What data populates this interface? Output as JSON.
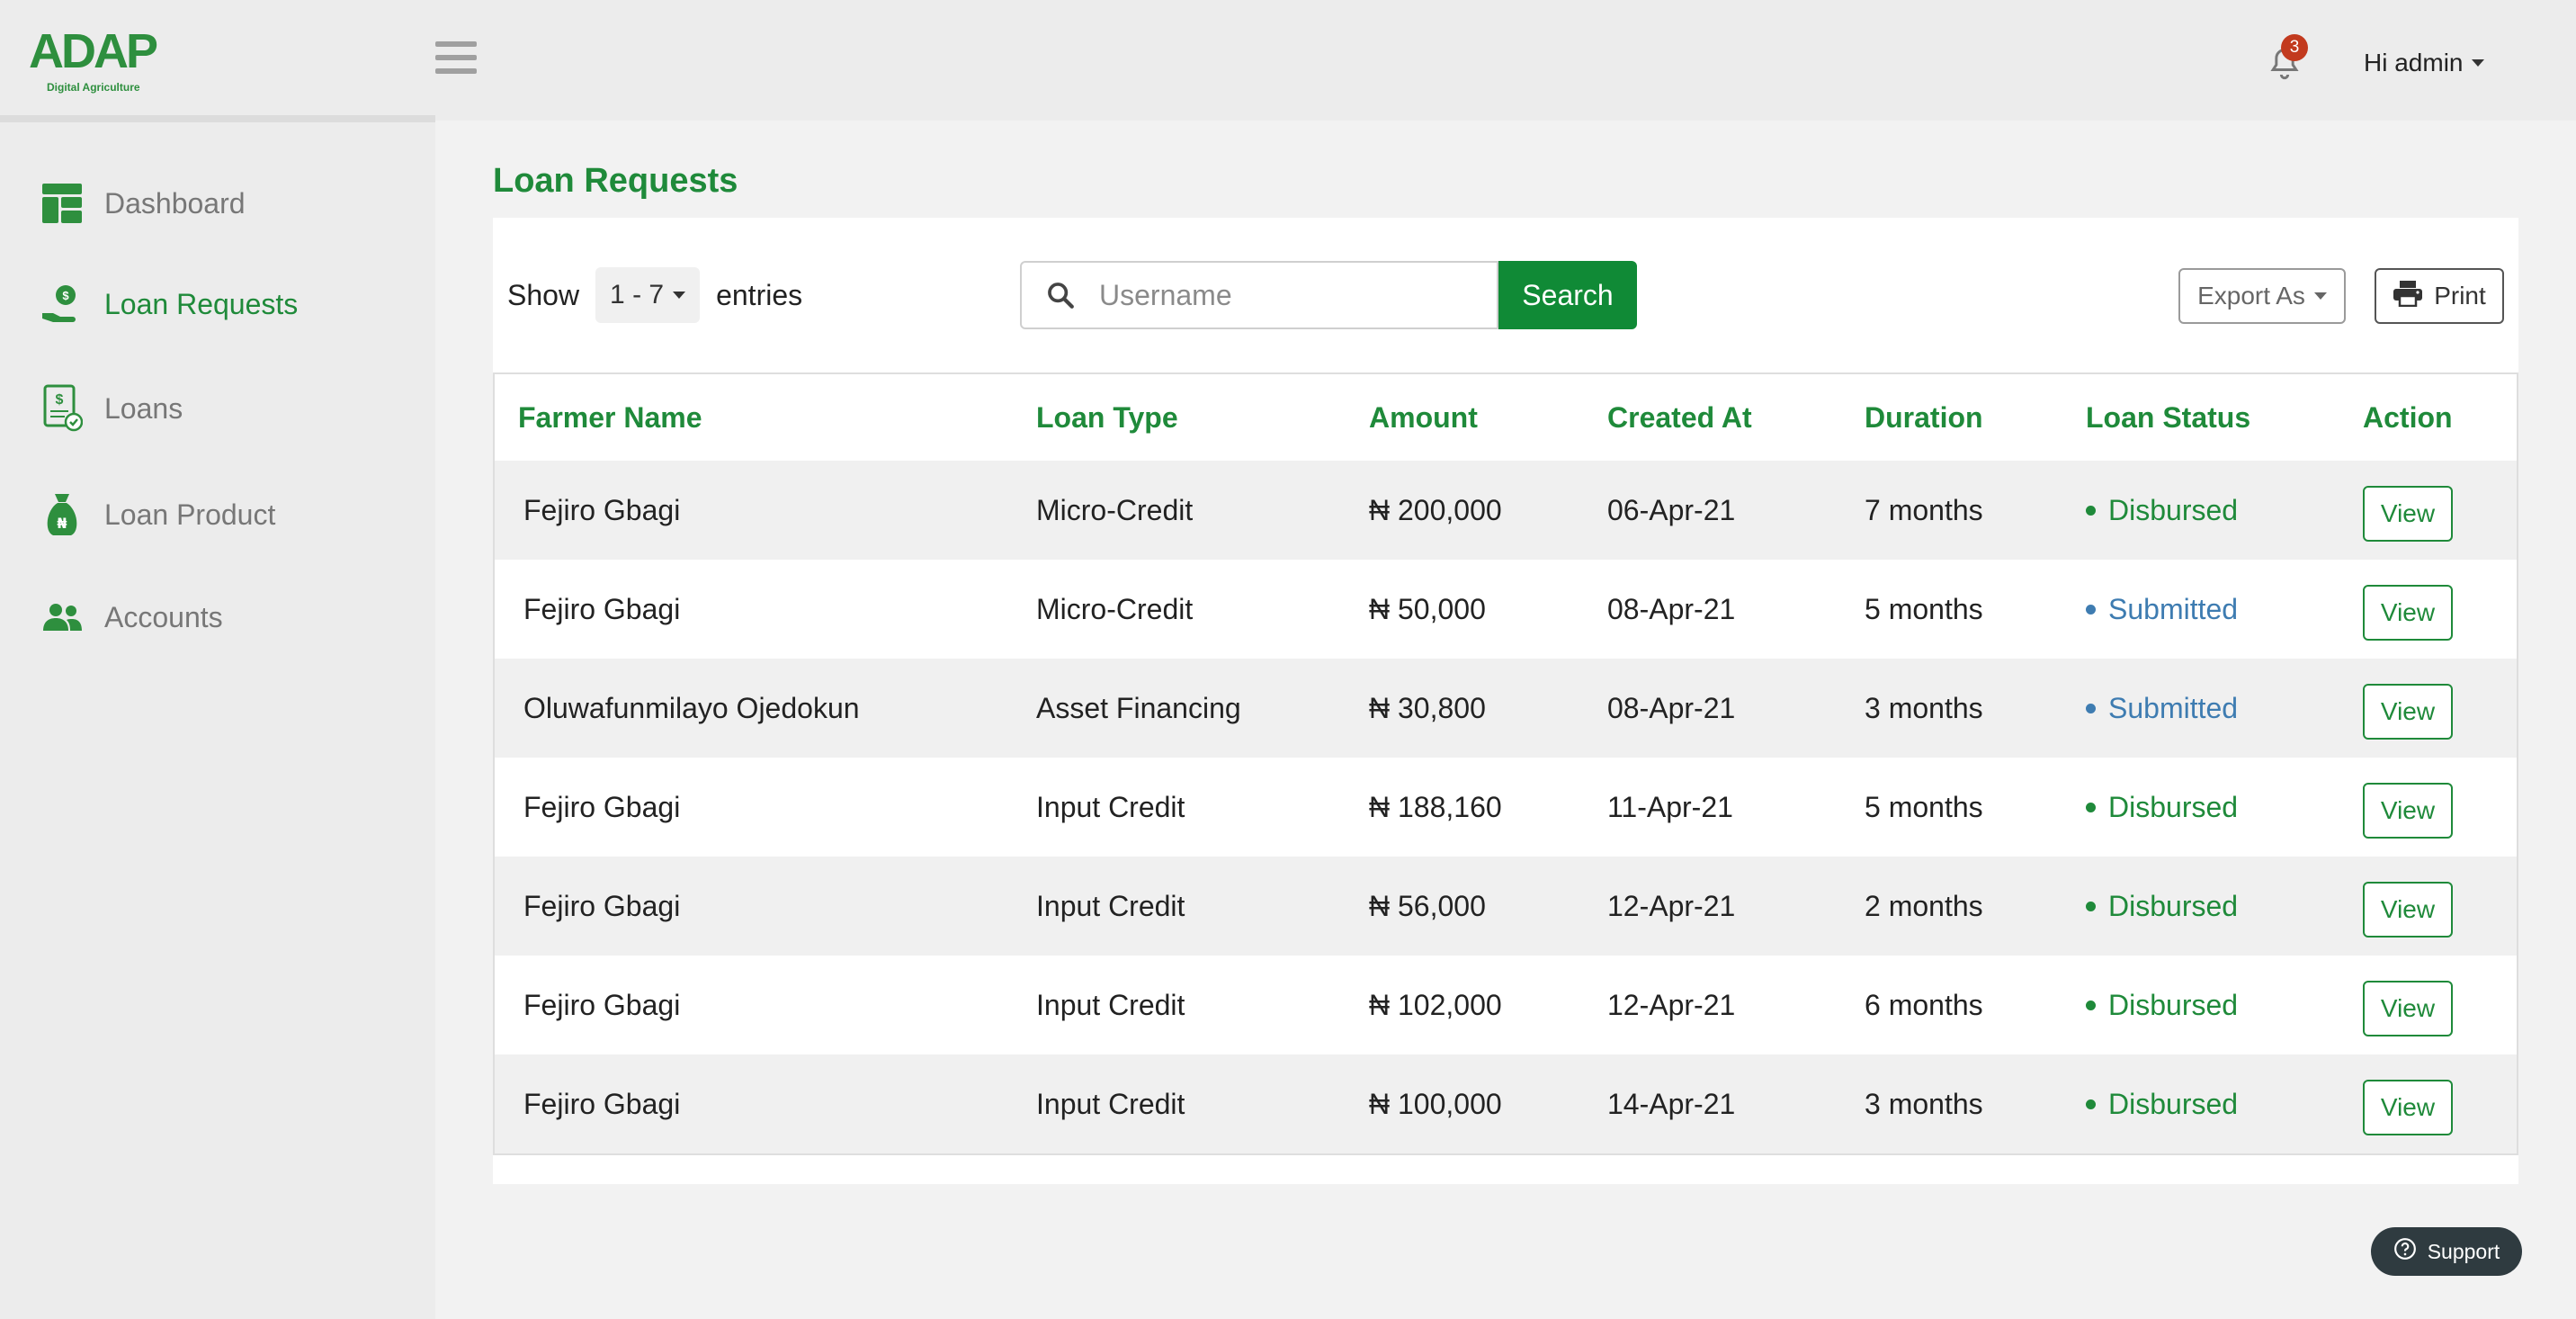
{
  "brand": {
    "name": "ADAP",
    "tagline": "Digital Agriculture"
  },
  "header": {
    "notification_count": "3",
    "user_label": "Hi admin"
  },
  "sidebar": {
    "items": [
      {
        "label": "Dashboard",
        "icon": "dashboard-icon",
        "active": false
      },
      {
        "label": "Loan Requests",
        "icon": "loan-request-icon",
        "active": true
      },
      {
        "label": "Loans",
        "icon": "loans-icon",
        "active": false
      },
      {
        "label": "Loan Product",
        "icon": "money-bag-icon",
        "active": false
      },
      {
        "label": "Accounts",
        "icon": "users-icon",
        "active": false
      }
    ]
  },
  "main": {
    "title": "Loan Requests",
    "show_label": "Show",
    "entries_value": "1 - 7",
    "entries_label": "entries",
    "search_placeholder": "Username",
    "search_button": "Search",
    "export_label": "Export As",
    "print_label": "Print"
  },
  "table": {
    "columns": [
      "Farmer Name",
      "Loan Type",
      "Amount",
      "Created At",
      "Duration",
      "Loan Status",
      "Action"
    ],
    "rows": [
      {
        "name": "Fejiro Gbagi",
        "type": "Micro-Credit",
        "amount": "₦ 200,000",
        "created": "06-Apr-21",
        "duration": "7 months",
        "status": "Disbursed",
        "action": "View"
      },
      {
        "name": "Fejiro Gbagi",
        "type": "Micro-Credit",
        "amount": "₦ 50,000",
        "created": "08-Apr-21",
        "duration": "5 months",
        "status": "Submitted",
        "action": "View"
      },
      {
        "name": "Oluwafunmilayo Ojedokun",
        "type": "Asset Financing",
        "amount": "₦ 30,800",
        "created": "08-Apr-21",
        "duration": "3 months",
        "status": "Submitted",
        "action": "View"
      },
      {
        "name": "Fejiro Gbagi",
        "type": "Input Credit",
        "amount": "₦ 188,160",
        "created": "11-Apr-21",
        "duration": "5 months",
        "status": "Disbursed",
        "action": "View"
      },
      {
        "name": "Fejiro Gbagi",
        "type": "Input Credit",
        "amount": "₦ 56,000",
        "created": "12-Apr-21",
        "duration": "2 months",
        "status": "Disbursed",
        "action": "View"
      },
      {
        "name": "Fejiro Gbagi",
        "type": "Input Credit",
        "amount": "₦ 102,000",
        "created": "12-Apr-21",
        "duration": "6 months",
        "status": "Disbursed",
        "action": "View"
      },
      {
        "name": "Fejiro Gbagi",
        "type": "Input Credit",
        "amount": "₦ 100,000",
        "created": "14-Apr-21",
        "duration": "3 months",
        "status": "Disbursed",
        "action": "View"
      }
    ]
  },
  "support": {
    "label": "Support"
  },
  "colors": {
    "brand_green": "#1f8a3a",
    "button_green": "#108a36",
    "submitted_blue": "#3e7cb1",
    "badge_red": "#c23a1e"
  }
}
